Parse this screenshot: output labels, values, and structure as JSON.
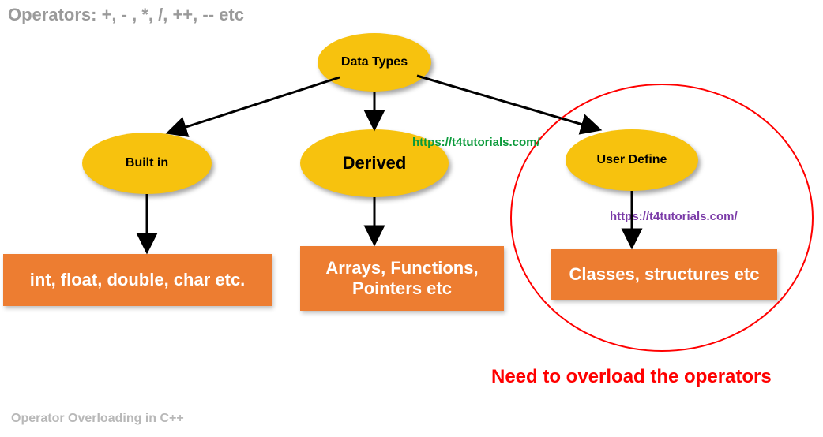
{
  "header": "Operators: +, - , *, /, ++, -- etc",
  "footer": "Operator Overloading in C++",
  "watermark_green": "https://t4tutorials.com/",
  "watermark_purple": "https://t4tutorials.com/",
  "callout": "Need to overload the operators",
  "nodes": {
    "root": "Data Types",
    "left": "Built in",
    "mid": "Derived",
    "right": "User Define"
  },
  "boxes": {
    "left": "int, float, double, char etc.",
    "mid": "Arrays, Functions, Pointers etc",
    "right": "Classes, structures etc"
  }
}
